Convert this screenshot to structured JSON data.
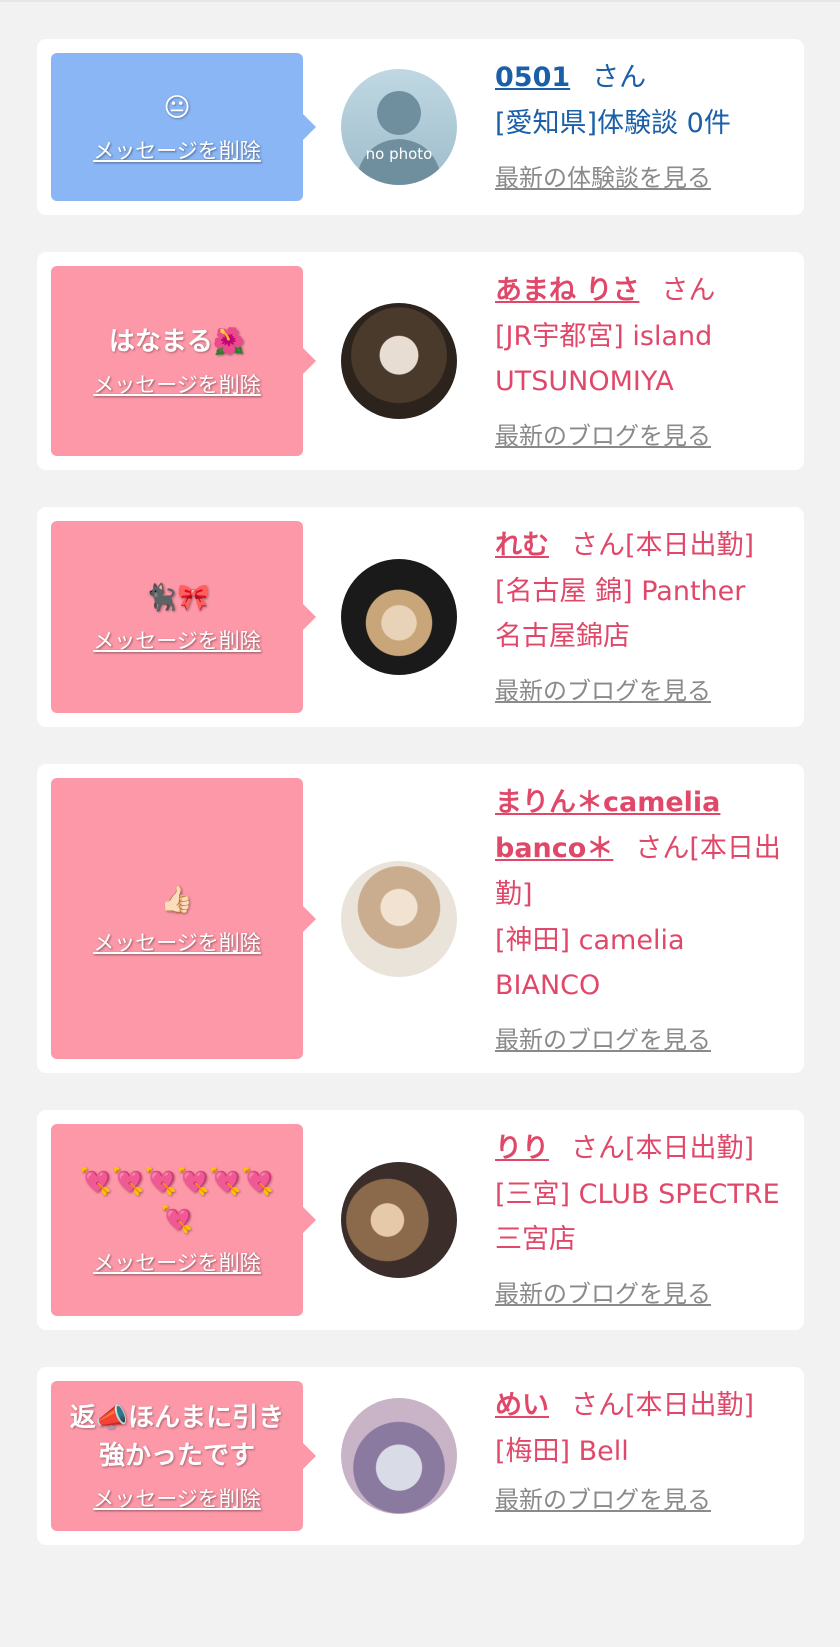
{
  "cards": [
    {
      "message": "😐",
      "delete_label": "メッセージを削除",
      "name": "0501",
      "suffix": "さん",
      "shop": "[愛知県]体験談 0件",
      "latest_link": "最新の体験談を見る",
      "avatar_text": "no photo",
      "theme": "blue"
    },
    {
      "message": "はなまる🌺",
      "delete_label": "メッセージを削除",
      "name": "あまね りさ",
      "suffix": "さん",
      "shop": "[JR宇都宮] island UTSUNOMIYA",
      "latest_link": "最新のブログを見る",
      "theme": "pink"
    },
    {
      "message": "🐈‍⬛🎀",
      "delete_label": "メッセージを削除",
      "name": "れむ",
      "suffix": "さん[本日出勤]",
      "shop": "[名古屋 錦] Panther 名古屋錦店",
      "latest_link": "最新のブログを見る",
      "theme": "pink"
    },
    {
      "message": "👍🏻",
      "delete_label": "メッセージを削除",
      "name": "まりん＊camelia banco＊",
      "suffix": "さん[本日出勤]",
      "shop": "[神田] camelia BIANCO",
      "latest_link": "最新のブログを見る",
      "theme": "pink"
    },
    {
      "message": "💘💘💘💘💘💘💘",
      "delete_label": "メッセージを削除",
      "name": "りり",
      "suffix": "さん[本日出勤]",
      "shop": "[三宮] CLUB SPECTRE 三宮店",
      "latest_link": "最新のブログを見る",
      "theme": "pink"
    },
    {
      "message": "返📣ほんまに引き強かったです",
      "delete_label": "メッセージを削除",
      "name": "めい",
      "suffix": "さん[本日出勤]",
      "shop": "[梅田] Bell",
      "latest_link": "最新のブログを見る",
      "theme": "pink"
    }
  ]
}
